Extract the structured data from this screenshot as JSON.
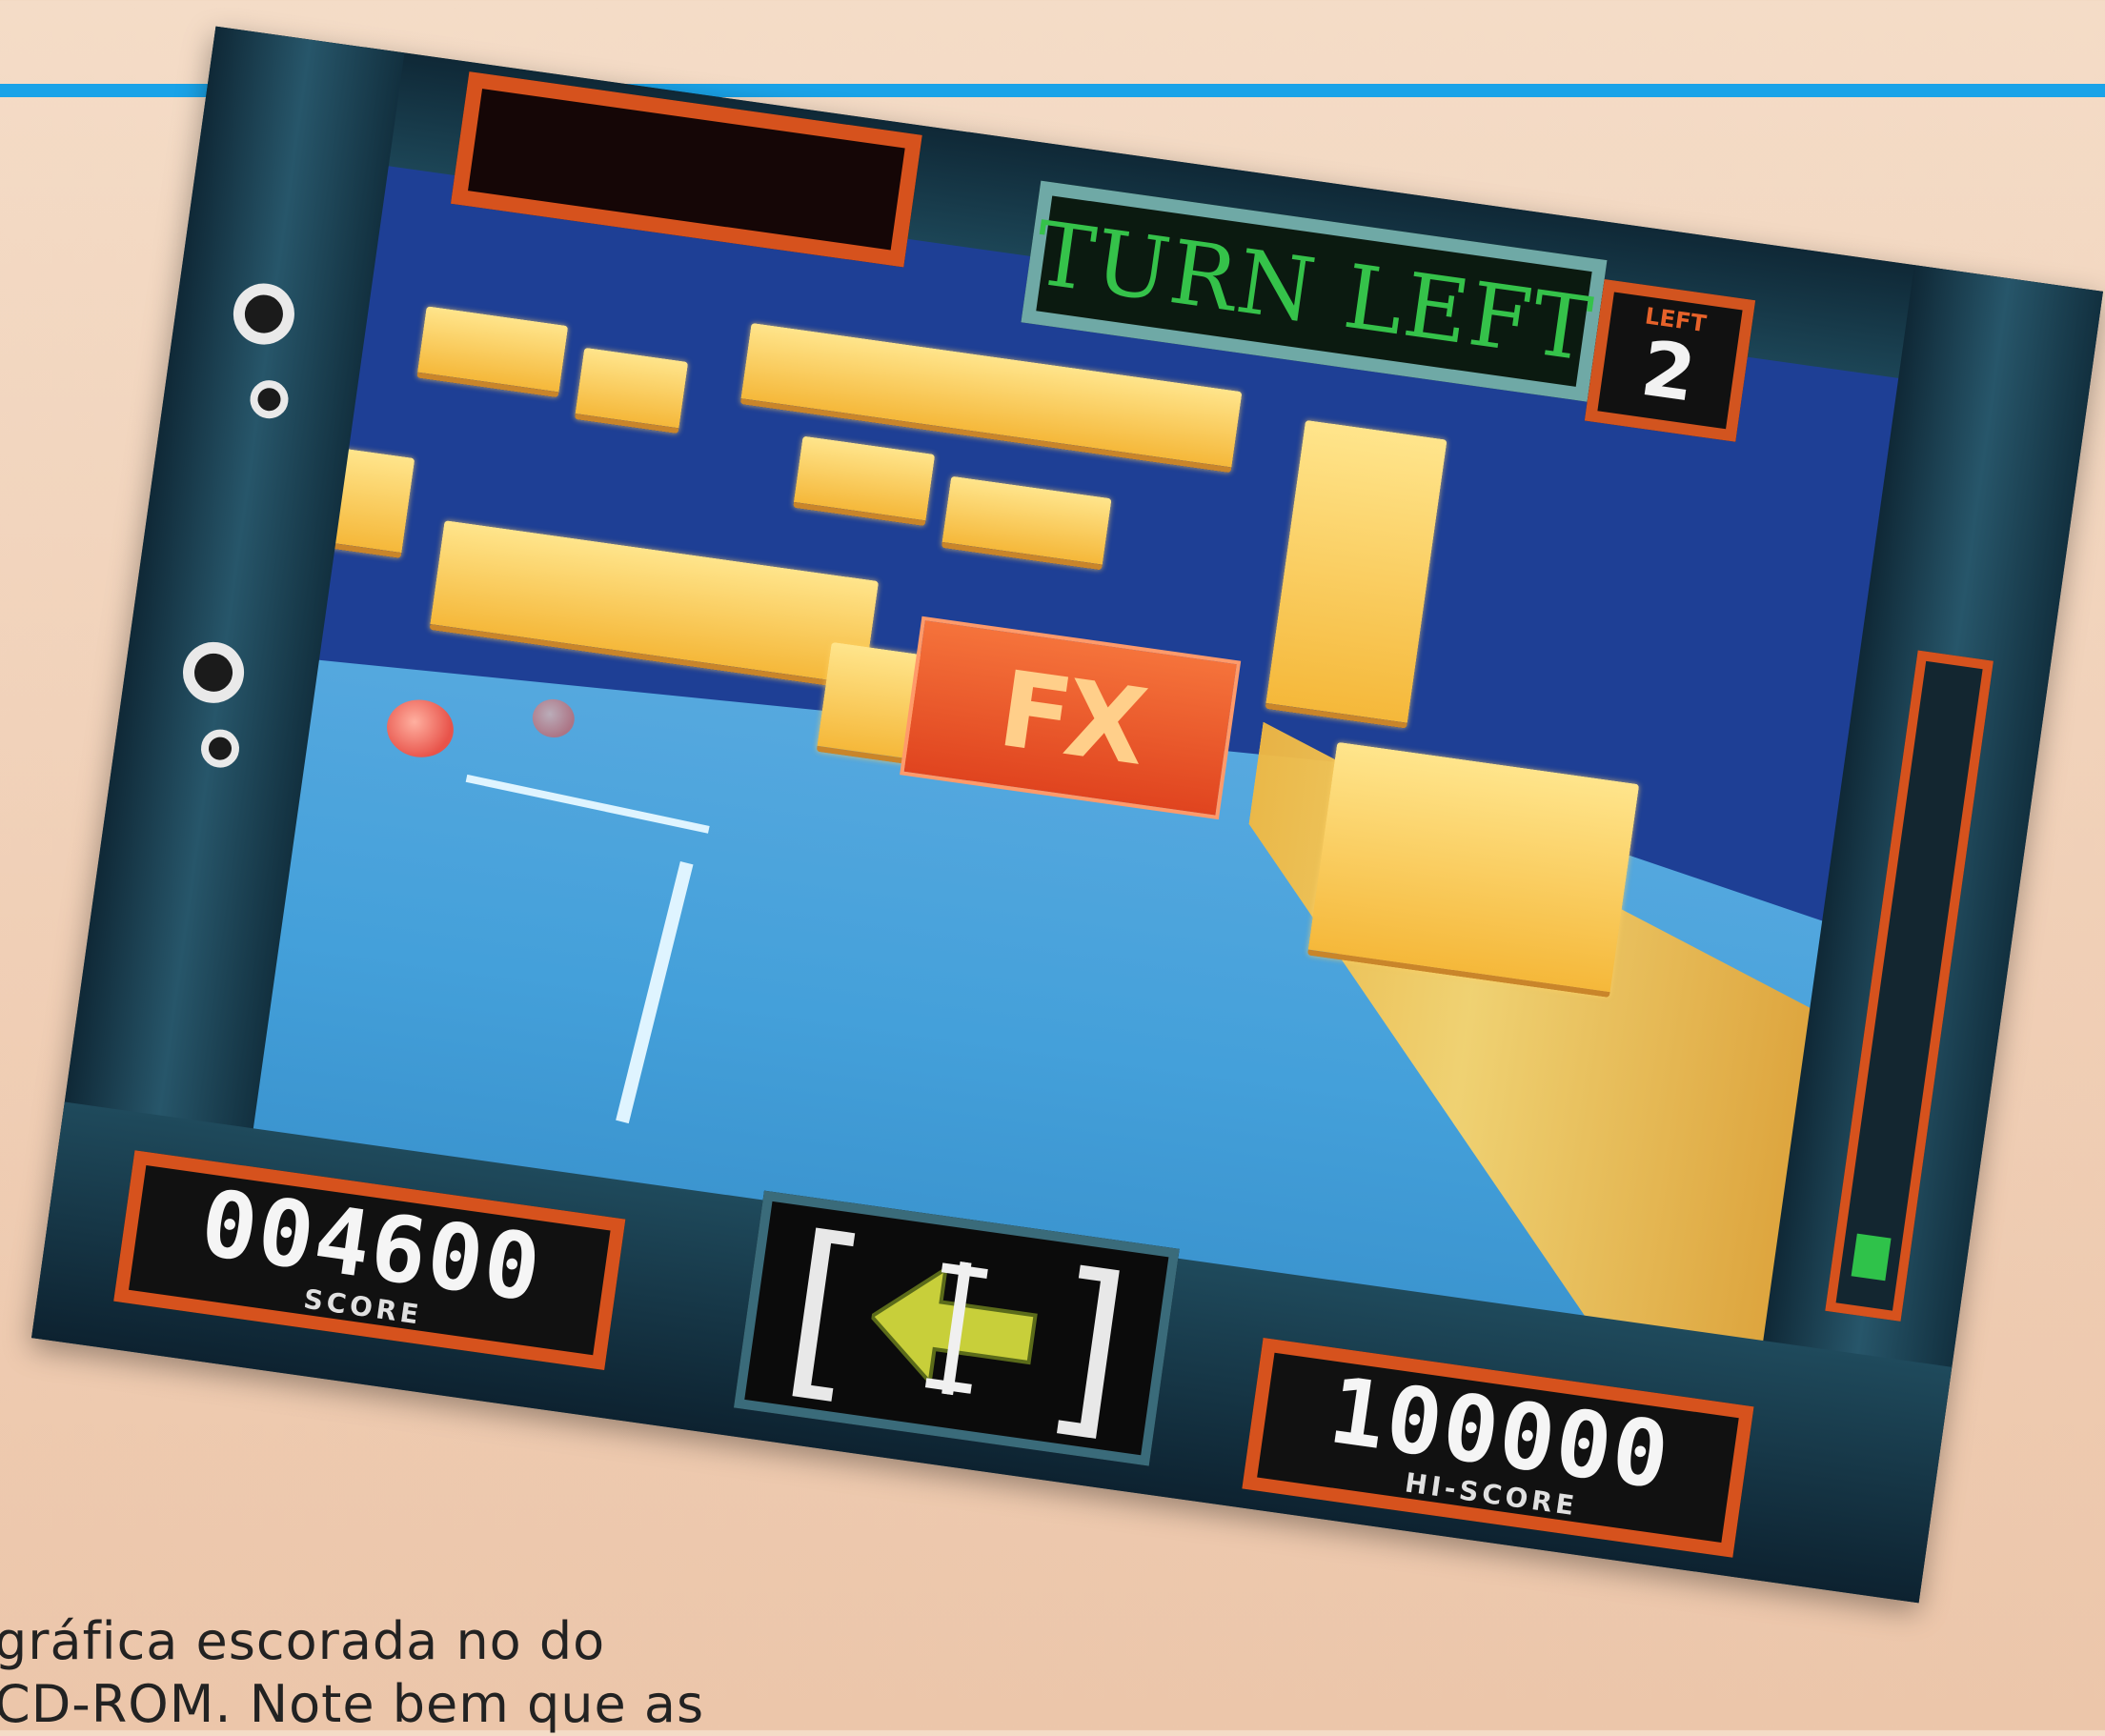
{
  "hud": {
    "message": "TURN LEFT",
    "lives_label": "LEFT",
    "lives_value": "2",
    "score": "004600",
    "score_sub": "SCORE",
    "hi_score": "100000",
    "hi_score_sub": "HI-SCORE",
    "direction_icon": "left-arrow-icon",
    "fuel_level": 0.07
  },
  "world": {
    "sign_text": "FX"
  },
  "caption": {
    "line1": "gráfica escorada no do",
    "line2": "CD-ROM. Note bem que as"
  }
}
